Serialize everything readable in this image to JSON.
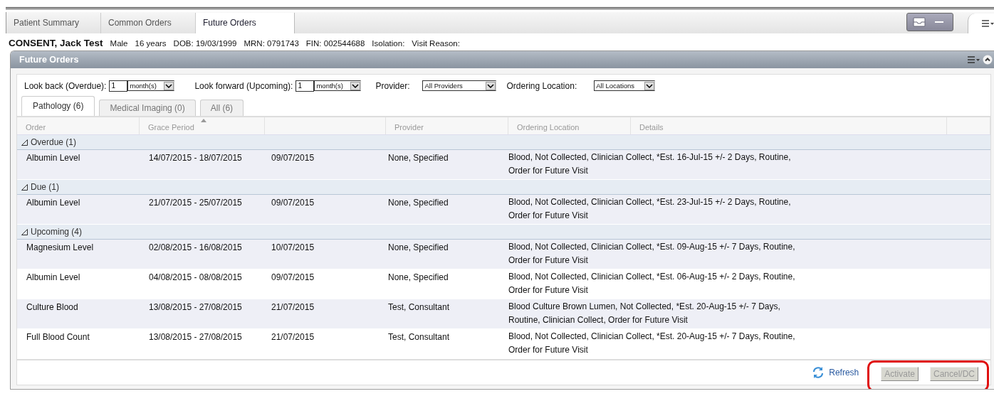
{
  "tabs": [
    {
      "label": "Patient Summary",
      "selected": false
    },
    {
      "label": "Common Orders",
      "selected": false
    },
    {
      "label": "Future Orders",
      "selected": true
    }
  ],
  "patient": {
    "name": "CONSENT, Jack Test",
    "fields": [
      "Male",
      "16 years",
      "DOB: 19/03/1999",
      "MRN: 0791743",
      "FIN: 002544688",
      "Isolation:",
      "Visit Reason:"
    ]
  },
  "panel": {
    "title": "Future Orders"
  },
  "filters": {
    "look_back": {
      "label": "Look back (Overdue):",
      "value": "1",
      "unit": "month(s)"
    },
    "look_forward": {
      "label": "Look forward (Upcoming):",
      "value": "1",
      "unit": "month(s)"
    },
    "provider": {
      "label": "Provider:",
      "value": "All Providers"
    },
    "ordering_location": {
      "label": "Ordering Location:",
      "value": "All Locations"
    }
  },
  "subtabs": [
    {
      "label": "Pathology (6)",
      "selected": true
    },
    {
      "label": "Medical Imaging (0)",
      "selected": false
    },
    {
      "label": "All (6)",
      "selected": false
    }
  ],
  "columns": [
    {
      "label": "Order",
      "sorted": false
    },
    {
      "label": "Grace Period",
      "sorted": true
    },
    {
      "sorted": false
    },
    {
      "label": "Provider",
      "sorted": false
    },
    {
      "label": "Ordering Location",
      "sorted": false
    },
    {
      "label": "Details",
      "sorted": false
    }
  ],
  "groups": [
    {
      "label": "Overdue (1)",
      "expanded": true,
      "rows": [
        {
          "order": "Albumin Level",
          "grace_period": "14/07/2015 - 18/07/2015",
          "column_3": "09/07/2015",
          "provider": "None, Specified",
          "details": "Blood, Not Collected, Clinician Collect, *Est. 16-Jul-15 +/- 2 Days, Routine, Order for Future Visit"
        }
      ]
    },
    {
      "label": "Due (1)",
      "expanded": true,
      "rows": [
        {
          "order": "Albumin Level",
          "grace_period": "21/07/2015 - 25/07/2015",
          "column_3": "09/07/2015",
          "provider": "None, Specified",
          "details": "Blood, Not Collected, Clinician Collect, *Est. 23-Jul-15 +/- 2 Days, Routine, Order for Future Visit"
        }
      ]
    },
    {
      "label": "Upcoming (4)",
      "expanded": true,
      "rows": [
        {
          "order": "Magnesium Level",
          "grace_period": "02/08/2015 - 16/08/2015",
          "column_3": "10/07/2015",
          "provider": "None, Specified",
          "details": "Blood, Not Collected, Clinician Collect, *Est. 09-Aug-15 +/- 7 Days, Routine, Order for Future Visit"
        },
        {
          "order": "Albumin Level",
          "grace_period": "04/08/2015 - 08/08/2015",
          "column_3": "09/07/2015",
          "provider": "None, Specified",
          "details": "Blood, Not Collected, Clinician Collect, *Est. 06-Aug-15 +/- 2 Days, Routine, Order for Future Visit"
        },
        {
          "order": "Culture Blood",
          "grace_period": "13/08/2015 - 27/08/2015",
          "column_3": "21/07/2015",
          "provider": "Test, Consultant",
          "details": "Blood Culture Brown Lumen, Not Collected, *Est. 20-Aug-15 +/- 7 Days, Routine, Clinician Collect, Order for Future Visit"
        },
        {
          "order": "Full Blood Count",
          "grace_period": "13/08/2015 - 27/08/2015",
          "column_3": "21/07/2015",
          "provider": "Test, Consultant",
          "details": "Blood, Not Collected, Clinician Collect, *Est. 20-Aug-15 +/- 7 Days, Routine, Order for Future Visit"
        }
      ]
    }
  ],
  "footer": {
    "refresh": "Refresh",
    "buttons": [
      {
        "label": "Activate",
        "disabled": true
      },
      {
        "label": "Cancel/DC",
        "disabled": true
      }
    ]
  }
}
